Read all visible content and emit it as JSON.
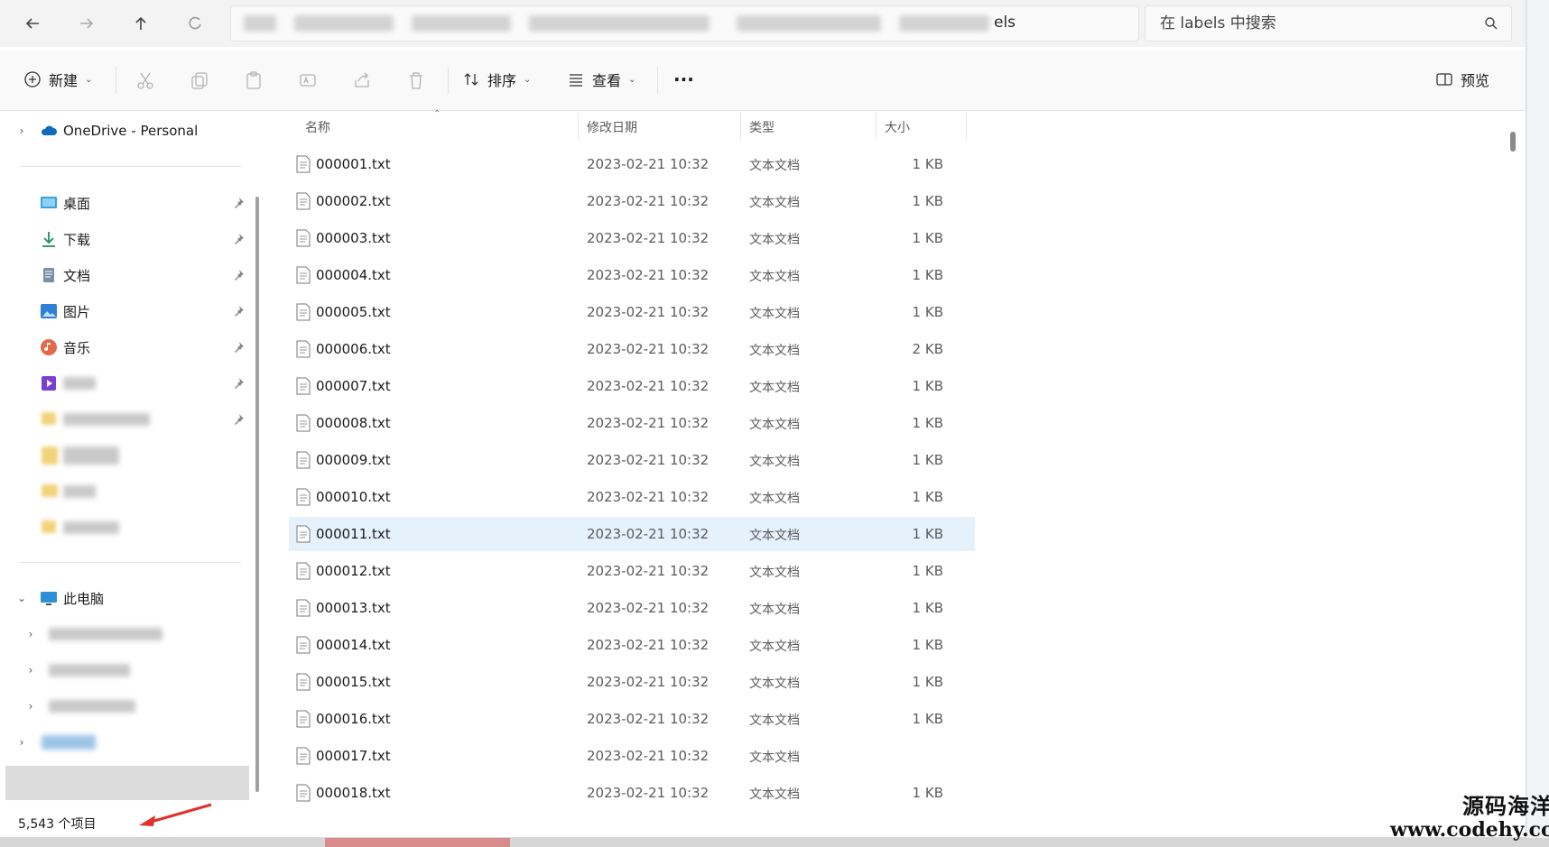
{
  "address_bar": {
    "path_tail": "els",
    "search_placeholder": "在 labels 中搜索"
  },
  "toolbar": {
    "new_label": "新建",
    "sort_label": "排序",
    "view_label": "查看",
    "more_label": "···",
    "preview_label": "预览"
  },
  "sidebar": {
    "onedrive_label": "OneDrive - Personal",
    "quick": [
      {
        "label": "桌面",
        "icon": "desktop-icon"
      },
      {
        "label": "下载",
        "icon": "download-icon"
      },
      {
        "label": "文档",
        "icon": "document-icon"
      },
      {
        "label": "图片",
        "icon": "pictures-icon"
      },
      {
        "label": "音乐",
        "icon": "music-icon"
      }
    ],
    "this_pc_label": "此电脑"
  },
  "columns": {
    "name": "名称",
    "date": "修改日期",
    "type": "类型",
    "size": "大小"
  },
  "files": [
    {
      "name": "000001.txt",
      "date": "2023-02-21 10:32",
      "type": "文本文档",
      "size": "1 KB"
    },
    {
      "name": "000002.txt",
      "date": "2023-02-21 10:32",
      "type": "文本文档",
      "size": "1 KB"
    },
    {
      "name": "000003.txt",
      "date": "2023-02-21 10:32",
      "type": "文本文档",
      "size": "1 KB"
    },
    {
      "name": "000004.txt",
      "date": "2023-02-21 10:32",
      "type": "文本文档",
      "size": "1 KB"
    },
    {
      "name": "000005.txt",
      "date": "2023-02-21 10:32",
      "type": "文本文档",
      "size": "1 KB"
    },
    {
      "name": "000006.txt",
      "date": "2023-02-21 10:32",
      "type": "文本文档",
      "size": "2 KB"
    },
    {
      "name": "000007.txt",
      "date": "2023-02-21 10:32",
      "type": "文本文档",
      "size": "1 KB"
    },
    {
      "name": "000008.txt",
      "date": "2023-02-21 10:32",
      "type": "文本文档",
      "size": "1 KB"
    },
    {
      "name": "000009.txt",
      "date": "2023-02-21 10:32",
      "type": "文本文档",
      "size": "1 KB"
    },
    {
      "name": "000010.txt",
      "date": "2023-02-21 10:32",
      "type": "文本文档",
      "size": "1 KB"
    },
    {
      "name": "000011.txt",
      "date": "2023-02-21 10:32",
      "type": "文本文档",
      "size": "1 KB",
      "selected": true
    },
    {
      "name": "000012.txt",
      "date": "2023-02-21 10:32",
      "type": "文本文档",
      "size": "1 KB"
    },
    {
      "name": "000013.txt",
      "date": "2023-02-21 10:32",
      "type": "文本文档",
      "size": "1 KB"
    },
    {
      "name": "000014.txt",
      "date": "2023-02-21 10:32",
      "type": "文本文档",
      "size": "1 KB"
    },
    {
      "name": "000015.txt",
      "date": "2023-02-21 10:32",
      "type": "文本文档",
      "size": "1 KB"
    },
    {
      "name": "000016.txt",
      "date": "2023-02-21 10:32",
      "type": "文本文档",
      "size": "1 KB"
    },
    {
      "name": "000017.txt",
      "date": "2023-02-21 10:32",
      "type": "文本文档",
      "size": ""
    },
    {
      "name": "000018.txt",
      "date": "2023-02-21 10:32",
      "type": "文本文档",
      "size": "1 KB"
    }
  ],
  "status": {
    "item_count": "5,543 个项目"
  },
  "watermark": {
    "line1": "源码海洋网",
    "line2": "www.codehy.com"
  },
  "colors": {
    "selection": "#e5f1fb",
    "onedrive_blue": "#0f6cbd",
    "annotation_red": "#e0312b"
  }
}
